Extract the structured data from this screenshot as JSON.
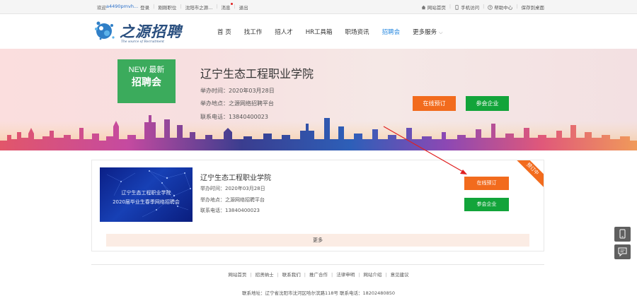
{
  "topbar": {
    "welcome": "欢迎",
    "username": "a4490pmvh...",
    "login": "登录",
    "recent_jobs": "刚刚职位",
    "location": "沈阳市之源...",
    "messages": "消息",
    "logout": "退出",
    "home": "网站首页",
    "mobile": "手机访问",
    "help": "帮助中心",
    "save_desktop": "保存到桌面"
  },
  "logo": {
    "cn": "之源招聘",
    "en": "The source of Recruitment"
  },
  "nav": {
    "items": [
      {
        "label": "首 页"
      },
      {
        "label": "找工作"
      },
      {
        "label": "招人才"
      },
      {
        "label": "HR工具箱"
      },
      {
        "label": "职场资讯"
      },
      {
        "label": "招聘会"
      },
      {
        "label": "更多服务"
      }
    ]
  },
  "banner": {
    "badge_line1": "NEW 最新",
    "badge_line2": "招聘会",
    "title": "辽宁生态工程职业学院",
    "time": "举办时间：2020年03月28日",
    "place": "举办地点：之源网络招聘平台",
    "phone": "联系电话：13840400023",
    "book_label": "在线预订",
    "join_label": "参会企业"
  },
  "card": {
    "thumb_line1": "辽宁生态工程职业学院",
    "thumb_line2": "2020届毕业生春季网络招聘会",
    "title": "辽宁生态工程职业学院",
    "time": "举办时间：2020年03月28日",
    "place": "举办地点：之源网络招聘平台",
    "phone": "联系电话：13840400023",
    "book_label": "在线预订",
    "join_label": "参会企业",
    "ribbon": "预订中",
    "more": "更多"
  },
  "footer": {
    "links": [
      "网站首页",
      "招贤纳士",
      "联系我们",
      "推广合作",
      "法律申明",
      "网站介绍",
      "意见建议"
    ],
    "address": "联系地址：辽宁省沈阳市沈河区哈尔滨路118号 联系电话：18202480850"
  },
  "colors": {
    "accent_blue": "#2a8ae0",
    "button_orange": "#f26b1d",
    "button_green": "#12a43a",
    "badge_green": "#3bab5c"
  },
  "icons": {
    "home": "home-icon",
    "mobile": "mobile-icon",
    "help": "help-icon",
    "desktop": "desktop-icon",
    "side_phone": "phone-icon",
    "side_feedback": "feedback-icon"
  }
}
